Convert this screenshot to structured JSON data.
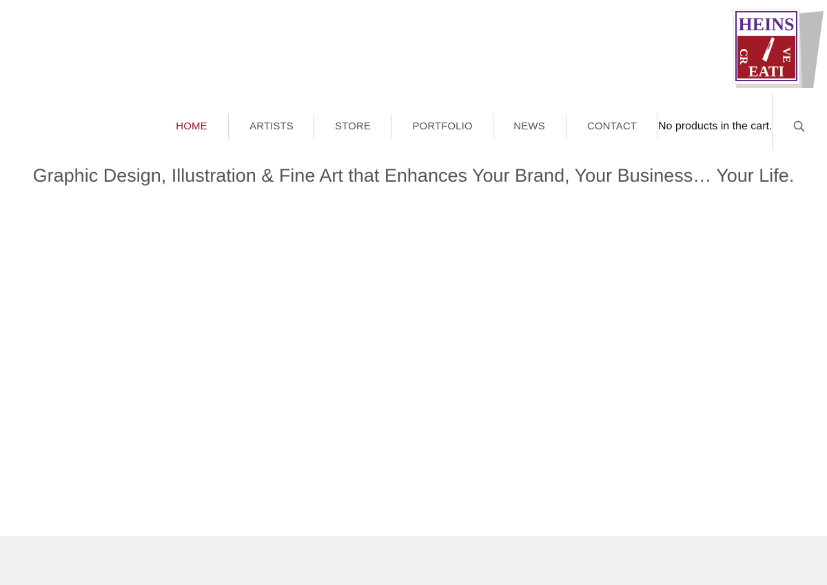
{
  "logo": {
    "text_top": "HEINS",
    "text_mid": "CR",
    "text_mid2": "VE",
    "text_bottom": "EATI",
    "alt": "Heins Creative"
  },
  "nav": {
    "items": [
      {
        "label": "HOME",
        "active": true
      },
      {
        "label": "ARTISTS",
        "active": false
      },
      {
        "label": "STORE",
        "active": false
      },
      {
        "label": "PORTFOLIO",
        "active": false
      },
      {
        "label": "NEWS",
        "active": false
      },
      {
        "label": "CONTACT",
        "active": false
      }
    ],
    "cart_text": "No products in the cart.",
    "search_icon": "search-icon"
  },
  "hero": {
    "tagline": "Graphic Design, Illustration & Fine Art that Enhances Your Brand, Your Business… Your Life."
  },
  "colors": {
    "accent": "#9b1b2c",
    "nav_text": "#555555",
    "logo_purple": "#5a2d8c",
    "logo_red": "#a01b26",
    "footer_bg": "#f1f0ef"
  }
}
